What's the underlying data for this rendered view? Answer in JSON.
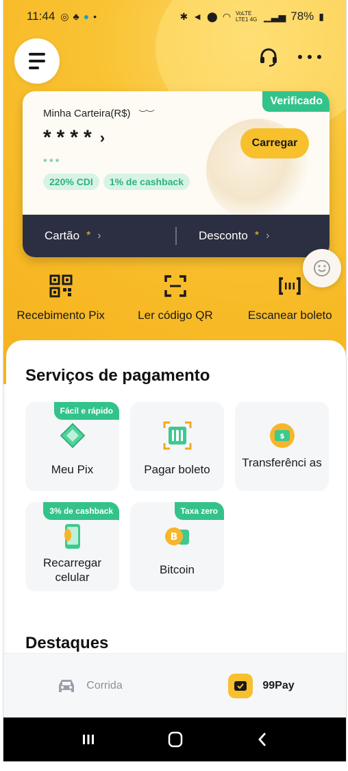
{
  "status_bar": {
    "time": "11:44",
    "battery": "78%",
    "network": "VoLTE LTE1 4G"
  },
  "header": {
    "menu_icon": "hamburger-icon",
    "support_icon": "headset-icon",
    "more_icon": "more-dots-icon"
  },
  "wallet": {
    "label": "Minha Carteira(R$)",
    "balance_masked": "****",
    "balance_chevron": "›",
    "yield_masked": "***",
    "badge": "Verificado",
    "load_button": "Carregar",
    "chips": [
      "220% CDI",
      "1% de cashback"
    ],
    "card_label": "Cartão",
    "card_value": "*",
    "discount_label": "Desconto",
    "discount_value": "*"
  },
  "quick_actions": [
    {
      "label": "Recebimento Pix",
      "icon": "qr-code-icon"
    },
    {
      "label": "Ler código QR",
      "icon": "scan-frame-icon"
    },
    {
      "label": "Escanear boleto",
      "icon": "barcode-scan-icon"
    }
  ],
  "services": {
    "title": "Serviços de pagamento",
    "items": [
      {
        "label": "Meu Pix",
        "tag": "Fácil e rápido",
        "icon": "pix-icon"
      },
      {
        "label": "Pagar boleto",
        "tag": "",
        "icon": "boleto-icon"
      },
      {
        "label": "Transferênci as",
        "tag": "",
        "icon": "transfer-icon"
      },
      {
        "label": "Recarregar celular",
        "tag": "3% de cashback",
        "icon": "phone-recharge-icon"
      },
      {
        "label": "Bitcoin",
        "tag": "Taxa zero",
        "icon": "bitcoin-icon"
      }
    ]
  },
  "highlights": {
    "title": "Destaques"
  },
  "tabs": [
    {
      "label": "Corrida",
      "icon": "car-icon",
      "active": false
    },
    {
      "label": "99Pay",
      "icon": "wallet-pay-icon",
      "active": true
    }
  ],
  "nav": [
    "recents-icon",
    "home-icon",
    "back-icon"
  ],
  "colors": {
    "brand_yellow": "#f7c02c",
    "accent_green": "#33c38a",
    "card_dark": "#2c2f42"
  }
}
